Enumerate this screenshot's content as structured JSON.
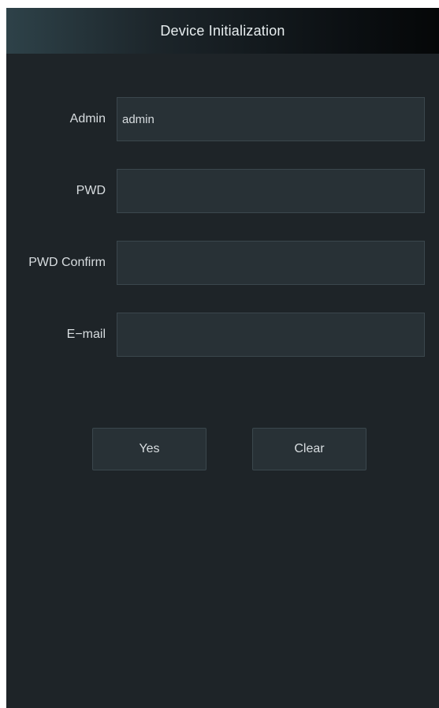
{
  "header": {
    "title": "Device Initialization"
  },
  "form": {
    "fields": [
      {
        "label": "Admin",
        "value": "admin",
        "placeholder": ""
      },
      {
        "label": "PWD",
        "value": "",
        "placeholder": ""
      },
      {
        "label": "PWD Confirm",
        "value": "",
        "placeholder": ""
      },
      {
        "label": "E−mail",
        "value": "",
        "placeholder": ""
      }
    ]
  },
  "actions": {
    "yes_label": "Yes",
    "clear_label": "Clear"
  },
  "colors": {
    "background": "#1e2428",
    "field_background": "#283136",
    "field_border": "#3b474d",
    "text": "#d8dde0"
  }
}
